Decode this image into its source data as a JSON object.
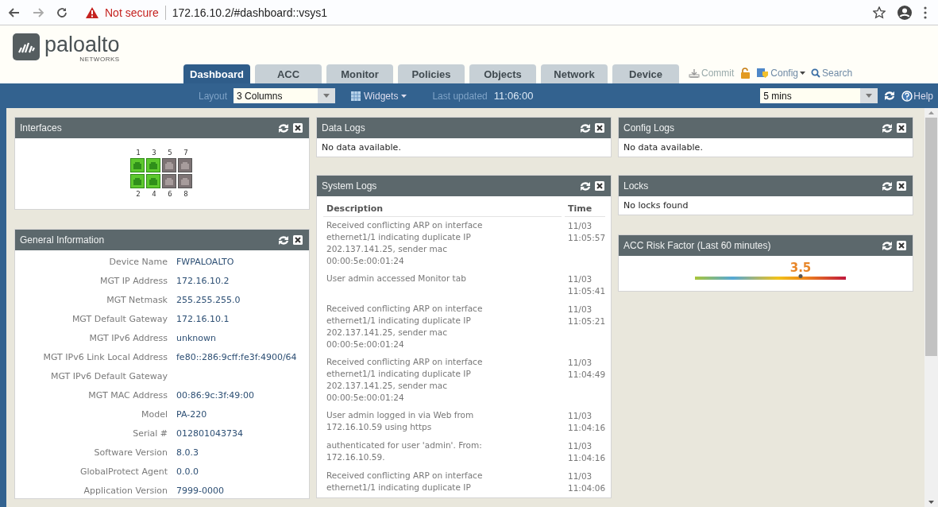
{
  "browser": {
    "warning": "Not secure",
    "url": "172.16.10.2/#dashboard::vsys1"
  },
  "logo": {
    "name": "paloalto",
    "sub": "NETWORKS"
  },
  "tabs": [
    {
      "label": "Dashboard",
      "selected": true
    },
    {
      "label": "ACC",
      "selected": false
    },
    {
      "label": "Monitor",
      "selected": false
    },
    {
      "label": "Policies",
      "selected": false
    },
    {
      "label": "Objects",
      "selected": false
    },
    {
      "label": "Network",
      "selected": false
    },
    {
      "label": "Device",
      "selected": false
    }
  ],
  "actions": {
    "commit": "Commit",
    "config": "Config",
    "search": "Search"
  },
  "toolbar": {
    "layout_label": "Layout",
    "layout": "3 Columns",
    "widgets": "Widgets",
    "updated_label": "Last updated",
    "updated": "11:06:00",
    "interval": "5 mins",
    "help": "Help"
  },
  "columns": [
    [
      {
        "kind": "interfaces",
        "title": "Interfaces",
        "ports": [
          {
            "label": "1",
            "up": true
          },
          {
            "label": "2",
            "up": true
          },
          {
            "label": "3",
            "up": true
          },
          {
            "label": "4",
            "up": true
          },
          {
            "label": "5",
            "up": false
          },
          {
            "label": "6",
            "up": false
          },
          {
            "label": "7",
            "up": false
          },
          {
            "label": "8",
            "up": false
          }
        ]
      },
      {
        "kind": "info",
        "title": "General Information",
        "rows": [
          {
            "label": "Device Name",
            "value": "FWPALOALTO"
          },
          {
            "label": "MGT IP Address",
            "value": "172.16.10.2"
          },
          {
            "label": "MGT Netmask",
            "value": "255.255.255.0"
          },
          {
            "label": "MGT Default Gateway",
            "value": "172.16.10.1"
          },
          {
            "label": "MGT IPv6 Address",
            "value": "unknown"
          },
          {
            "label": "MGT IPv6 Link Local Address",
            "value": "fe80::286:9cff:fe3f:4900/64"
          },
          {
            "label": "MGT IPv6 Default Gateway"
          },
          {
            "label": "MGT MAC Address",
            "value": "00:86:9c:3f:49:00"
          },
          {
            "label": "Model",
            "value": "PA-220"
          },
          {
            "label": "Serial #",
            "value": "012801043734"
          },
          {
            "label": "Software Version",
            "value": "8.0.3"
          },
          {
            "label": "GlobalProtect Agent",
            "value": "0.0.0"
          },
          {
            "label": "Application Version",
            "value": "7999-0000"
          }
        ]
      }
    ],
    [
      {
        "kind": "message",
        "title": "Data Logs",
        "text": "No data available."
      },
      {
        "kind": "table",
        "title": "System Logs",
        "columns": [
          "Description",
          "Time"
        ],
        "rows": [
          {
            "description": "Received conflicting ARP on interface ethernet1/1 indicating duplicate IP 202.137.141.25, sender mac 00:00:5e:00:01:24",
            "date": "11/03",
            "time": "11:05:57"
          },
          {
            "description": "User admin accessed Monitor tab",
            "date": "11/03",
            "time": "11:05:41"
          },
          {
            "description": "Received conflicting ARP on interface ethernet1/1 indicating duplicate IP 202.137.141.25, sender mac 00:00:5e:00:01:24",
            "date": "11/03",
            "time": "11:05:21"
          },
          {
            "description": "Received conflicting ARP on interface ethernet1/1 indicating duplicate IP 202.137.141.25, sender mac 00:00:5e:00:01:24",
            "date": "11/03",
            "time": "11:04:49"
          },
          {
            "description": "User admin logged in via Web from 172.16.10.59 using https",
            "date": "11/03",
            "time": "11:04:16"
          },
          {
            "description": "authenticated for user 'admin'. From: 172.16.10.59.",
            "date": "11/03",
            "time": "11:04:16"
          },
          {
            "description": "Received conflicting ARP on interface ethernet1/1 indicating duplicate IP",
            "date": "11/03",
            "time": "11:04:06"
          }
        ]
      }
    ],
    [
      {
        "kind": "message",
        "title": "Config Logs",
        "text": "No data available."
      },
      {
        "kind": "message",
        "title": "Locks",
        "text": "No locks found"
      },
      {
        "kind": "risk",
        "title": "ACC Risk Factor (Last 60 minutes)",
        "value": "3.5",
        "level": 0.7
      }
    ]
  ]
}
